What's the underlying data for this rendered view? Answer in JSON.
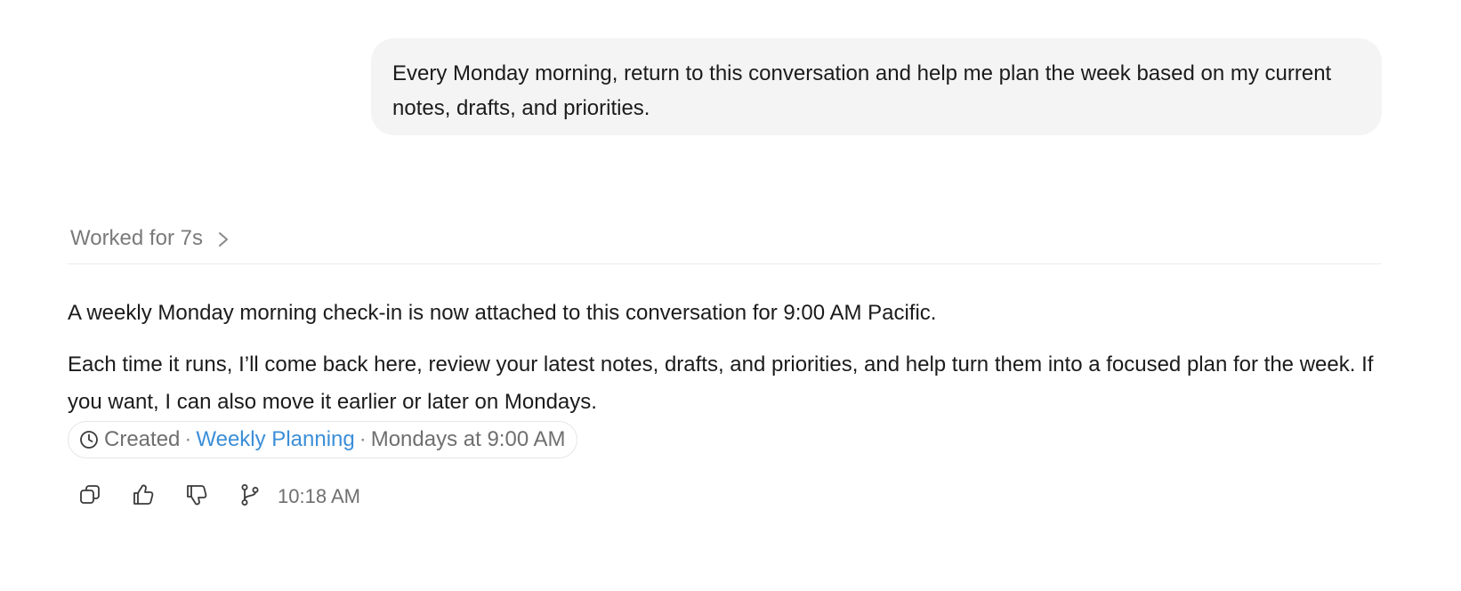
{
  "user_message": {
    "text": "Every Monday morning, return to this conversation and help me plan the week based on my current notes, drafts, and priorities."
  },
  "assistant": {
    "worked_label": "Worked for 7s",
    "paragraphs": [
      "A weekly Monday morning check-in is now attached to this conversation for 9:00 AM Pacific.",
      "Each time it runs, I’ll come back here, review your latest notes, drafts, and priorities, and help turn them into a focused plan for the week. If you want, I can also move it earlier or later on Mondays."
    ],
    "schedule": {
      "icon": "clock-icon",
      "status": "Created",
      "separator": "·",
      "task_name": "Weekly Planning",
      "when": "Mondays at 9:00 AM",
      "link_color": "#3b8ed8"
    },
    "actions": {
      "icons": [
        "copy-icon",
        "thumbs-up-icon",
        "thumbs-down-icon",
        "branch-icon"
      ],
      "timestamp": "10:18 AM"
    }
  }
}
